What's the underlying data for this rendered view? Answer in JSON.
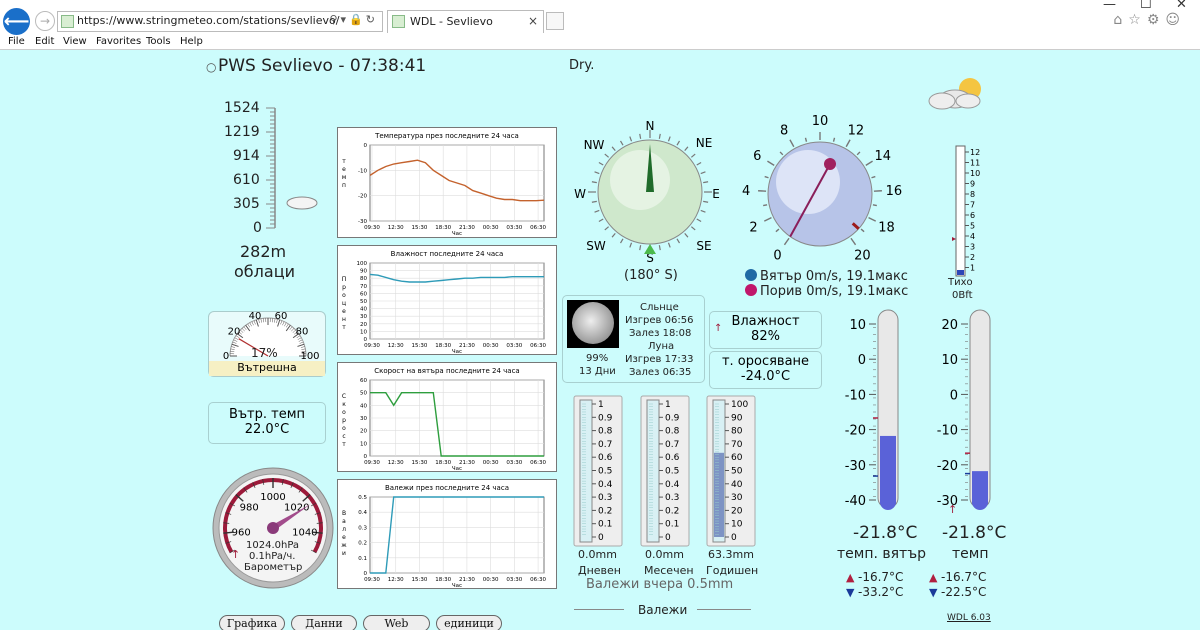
{
  "browser": {
    "url": "https://www.stringmeteo.com/stations/sevlievo/",
    "tab_title": "WDL - Sevlievo",
    "menu": [
      "File",
      "Edit",
      "View",
      "Favorites",
      "Tools",
      "Help"
    ]
  },
  "station": {
    "title": "PWS Sevlievo - 07:38:41",
    "condition": "Dry."
  },
  "altitude": {
    "scale": [
      "1524",
      "1219",
      "914",
      "610",
      "305",
      "0"
    ],
    "value": "282m",
    "label": "облаци"
  },
  "charts": [
    {
      "title": "Температура през последните 24 часа",
      "ylabel": "темп",
      "xlabel": "Час",
      "yticks": [
        "0",
        "-10",
        "-20",
        "-30"
      ],
      "xticks": [
        "09:30",
        "12:30",
        "15:30",
        "18:30",
        "21:30",
        "00:30",
        "03:30",
        "06:30"
      ]
    },
    {
      "title": "Влажност последните 24 часа",
      "ylabel": "Процент",
      "xlabel": "Час",
      "yticks": [
        "100",
        "90",
        "80",
        "70",
        "60",
        "50",
        "40",
        "30",
        "20",
        "10",
        "0"
      ],
      "xticks": [
        "09:30",
        "12:30",
        "15:30",
        "18:30",
        "21:30",
        "00:30",
        "03:30",
        "06:30"
      ]
    },
    {
      "title": "Скорост на вятъра последните 24 часа",
      "ylabel": "Скорост",
      "xlabel": "Час",
      "yticks": [
        "60",
        "50",
        "40",
        "30",
        "20",
        "10",
        "0"
      ],
      "xticks": [
        "09:30",
        "12:30",
        "15:30",
        "18:30",
        "21:30",
        "00:30",
        "03:30",
        "06:30"
      ]
    },
    {
      "title": "Валежи през последните 24 часа",
      "ylabel": "Валежи",
      "xlabel": "Час",
      "yticks": [
        "0.5",
        "0.4",
        "0.3",
        "0.2",
        "0.1",
        "0"
      ],
      "xticks": [
        "09:30",
        "12:30",
        "15:30",
        "18:30",
        "21:30",
        "00:30",
        "03:30",
        "06:30"
      ]
    }
  ],
  "chart_data": [
    {
      "type": "line",
      "title": "Температура през последните 24 часа",
      "ylabel": "темп",
      "xlabel": "Час",
      "categories": [
        "09:30",
        "10:30",
        "11:30",
        "12:30",
        "13:30",
        "14:30",
        "15:30",
        "16:30",
        "17:30",
        "18:30",
        "19:30",
        "20:30",
        "21:30",
        "22:30",
        "23:30",
        "00:30",
        "01:30",
        "02:30",
        "03:30",
        "04:30",
        "05:30",
        "06:30",
        "07:30"
      ],
      "series": [
        {
          "values": [
            -12,
            -10,
            -8.5,
            -7.5,
            -7,
            -6.5,
            -6,
            -7,
            -10,
            -12,
            -14,
            -15,
            -16,
            -18,
            -19,
            -20,
            -21,
            -21.5,
            -21.5,
            -22,
            -22,
            -22,
            -21.8
          ]
        }
      ],
      "ylim": [
        -30,
        0
      ]
    },
    {
      "type": "line",
      "title": "Влажност последните 24 часа",
      "ylabel": "Процент",
      "xlabel": "Час",
      "categories": [
        "09:30",
        "10:30",
        "11:30",
        "12:30",
        "13:30",
        "14:30",
        "15:30",
        "16:30",
        "17:30",
        "18:30",
        "19:30",
        "20:30",
        "21:30",
        "22:30",
        "23:30",
        "00:30",
        "01:30",
        "02:30",
        "03:30",
        "04:30",
        "05:30",
        "06:30",
        "07:30"
      ],
      "series": [
        {
          "values": [
            85,
            84,
            81,
            78,
            76,
            75,
            75,
            75,
            76,
            77,
            78,
            79,
            80,
            80,
            81,
            81,
            81,
            81,
            82,
            82,
            82,
            82,
            82
          ]
        }
      ],
      "ylim": [
        0,
        100
      ]
    },
    {
      "type": "line",
      "title": "Скорост на вятъра последните 24 часа",
      "ylabel": "Скорост",
      "xlabel": "Час",
      "categories": [
        "09:30",
        "10:30",
        "11:30",
        "12:30",
        "13:30",
        "14:30",
        "15:30",
        "16:30",
        "17:30",
        "18:30",
        "19:30",
        "20:30",
        "21:30",
        "22:30",
        "23:30",
        "00:30",
        "01:30",
        "02:30",
        "03:30",
        "04:30",
        "05:30",
        "06:30",
        "07:30"
      ],
      "series": [
        {
          "values": [
            50,
            50,
            50,
            40,
            50,
            50,
            50,
            50,
            50,
            0,
            0,
            0,
            0,
            0,
            0,
            0,
            0,
            0,
            0,
            0,
            0,
            0,
            0
          ]
        }
      ],
      "ylim": [
        0,
        60
      ]
    },
    {
      "type": "line",
      "title": "Валежи през последните 24 часа",
      "ylabel": "Валежи",
      "xlabel": "Час",
      "categories": [
        "09:30",
        "10:30",
        "11:30",
        "12:30",
        "13:30",
        "14:30",
        "15:30",
        "16:30",
        "17:30",
        "18:30",
        "19:30",
        "20:30",
        "21:30",
        "22:30",
        "23:30",
        "00:30",
        "01:30",
        "02:30",
        "03:30",
        "04:30",
        "05:30",
        "06:30",
        "07:30"
      ],
      "series": [
        {
          "values": [
            0,
            0,
            0,
            0.5,
            0.5,
            0.5,
            0.5,
            0.5,
            0.5,
            0.5,
            0.5,
            0.5,
            0.5,
            0.5,
            0.5,
            0.5,
            0.5,
            0.5,
            0.5,
            0.5,
            0.5,
            0.5,
            0.5
          ]
        }
      ],
      "ylim": [
        0,
        0.5
      ]
    }
  ],
  "humidity_gauge": {
    "ticks": [
      "0",
      "20",
      "40",
      "60",
      "80",
      "100"
    ],
    "value": "17%",
    "label": "Вътрешна Влажност",
    "percent": 17
  },
  "indoor": {
    "label": "Вътр. темп",
    "value": "22.0°C"
  },
  "barometer": {
    "ticks": [
      "960",
      "980",
      "1000",
      "1020",
      "1040"
    ],
    "value": "1024.0hPa",
    "trend": "0.1hPa/ч.",
    "label": "Барометър",
    "trend_arrow": "↑",
    "hpa": 1024.0
  },
  "compass": {
    "dirs": [
      "N",
      "NE",
      "E",
      "SE",
      "S",
      "SW",
      "W",
      "NW"
    ],
    "bearing": "(180° S)",
    "degrees": 180
  },
  "sun_moon": {
    "illumination": "99%",
    "age": "13 Дни",
    "sun_title": "Сльнце",
    "sunrise": "Изгрев 06:56",
    "sunset": "Залез 18:08",
    "moon_title": "Луна",
    "moonrise": "Изгрев 17:33",
    "moonset": "Залез 06:35"
  },
  "humidity": {
    "label": "Влажност",
    "value": "82%",
    "trend_arrow": "↑"
  },
  "dew": {
    "label": "т. оросяване",
    "value": "-24.0°C"
  },
  "rain": {
    "scale_small": [
      "1",
      "0.9",
      "0.8",
      "0.7",
      "0.6",
      "0.5",
      "0.4",
      "0.3",
      "0.2",
      "0.1",
      "0"
    ],
    "scale_large": [
      "100",
      "90",
      "80",
      "70",
      "60",
      "50",
      "40",
      "30",
      "20",
      "10",
      "0"
    ],
    "daily": {
      "value": "0.0mm",
      "label": "Дневен",
      "fill": 0
    },
    "monthly": {
      "value": "0.0mm",
      "label": "Месечен",
      "fill": 0
    },
    "yearly": {
      "value": "63.3mm",
      "label": "Годишен",
      "fill": 63.3
    },
    "yesterday": "Валежи вчера 0.5mm",
    "title": "Валежи"
  },
  "wind": {
    "ticks": [
      "0",
      "2",
      "4",
      "6",
      "8",
      "10",
      "12",
      "14",
      "16",
      "18",
      "20"
    ],
    "speed": "Вятър 0m/s, 19.1макс",
    "gust": "Порив 0m/s, 19.1макс",
    "speed_color": "#1f6aa5",
    "gust_color": "#c0176b",
    "value": 0,
    "max": 19.1
  },
  "beaufort": {
    "ticks": [
      "12",
      "11",
      "10",
      "9",
      "8",
      "7",
      "6",
      "5",
      "4",
      "3",
      "2",
      "1"
    ],
    "label": "Тихо",
    "value": "0Bft"
  },
  "windchill": {
    "ticks": [
      "10",
      "0",
      "-10",
      "-20",
      "-30",
      "-40"
    ],
    "value": "-21.8°C",
    "label": "темп. вятър",
    "high": "-16.7°C",
    "low": "-33.2°C",
    "celsius": -21.8
  },
  "temp": {
    "ticks": [
      "20",
      "10",
      "0",
      "-10",
      "-20",
      "-30"
    ],
    "value": "-21.8°C",
    "label": "темп",
    "high": "-16.7°C",
    "low": "-22.5°C",
    "celsius": -21.8,
    "trend_arrow": "↑"
  },
  "buttons": [
    "Графика",
    "Данни",
    "Web камера",
    "единици"
  ],
  "version": "WDL 6.03"
}
